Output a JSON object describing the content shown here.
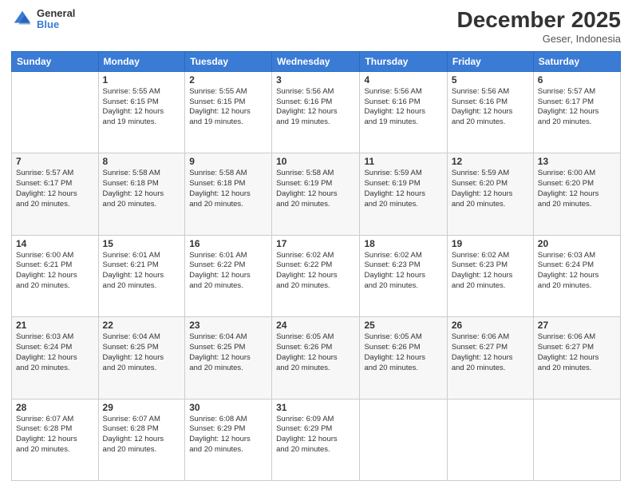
{
  "logo": {
    "general": "General",
    "blue": "Blue"
  },
  "header": {
    "month": "December 2025",
    "location": "Geser, Indonesia"
  },
  "weekdays": [
    "Sunday",
    "Monday",
    "Tuesday",
    "Wednesday",
    "Thursday",
    "Friday",
    "Saturday"
  ],
  "weeks": [
    [
      {
        "day": "",
        "info": ""
      },
      {
        "day": "1",
        "info": "Sunrise: 5:55 AM\nSunset: 6:15 PM\nDaylight: 12 hours\nand 19 minutes."
      },
      {
        "day": "2",
        "info": "Sunrise: 5:55 AM\nSunset: 6:15 PM\nDaylight: 12 hours\nand 19 minutes."
      },
      {
        "day": "3",
        "info": "Sunrise: 5:56 AM\nSunset: 6:16 PM\nDaylight: 12 hours\nand 19 minutes."
      },
      {
        "day": "4",
        "info": "Sunrise: 5:56 AM\nSunset: 6:16 PM\nDaylight: 12 hours\nand 19 minutes."
      },
      {
        "day": "5",
        "info": "Sunrise: 5:56 AM\nSunset: 6:16 PM\nDaylight: 12 hours\nand 20 minutes."
      },
      {
        "day": "6",
        "info": "Sunrise: 5:57 AM\nSunset: 6:17 PM\nDaylight: 12 hours\nand 20 minutes."
      }
    ],
    [
      {
        "day": "7",
        "info": "Sunrise: 5:57 AM\nSunset: 6:17 PM\nDaylight: 12 hours\nand 20 minutes."
      },
      {
        "day": "8",
        "info": "Sunrise: 5:58 AM\nSunset: 6:18 PM\nDaylight: 12 hours\nand 20 minutes."
      },
      {
        "day": "9",
        "info": "Sunrise: 5:58 AM\nSunset: 6:18 PM\nDaylight: 12 hours\nand 20 minutes."
      },
      {
        "day": "10",
        "info": "Sunrise: 5:58 AM\nSunset: 6:19 PM\nDaylight: 12 hours\nand 20 minutes."
      },
      {
        "day": "11",
        "info": "Sunrise: 5:59 AM\nSunset: 6:19 PM\nDaylight: 12 hours\nand 20 minutes."
      },
      {
        "day": "12",
        "info": "Sunrise: 5:59 AM\nSunset: 6:20 PM\nDaylight: 12 hours\nand 20 minutes."
      },
      {
        "day": "13",
        "info": "Sunrise: 6:00 AM\nSunset: 6:20 PM\nDaylight: 12 hours\nand 20 minutes."
      }
    ],
    [
      {
        "day": "14",
        "info": "Sunrise: 6:00 AM\nSunset: 6:21 PM\nDaylight: 12 hours\nand 20 minutes."
      },
      {
        "day": "15",
        "info": "Sunrise: 6:01 AM\nSunset: 6:21 PM\nDaylight: 12 hours\nand 20 minutes."
      },
      {
        "day": "16",
        "info": "Sunrise: 6:01 AM\nSunset: 6:22 PM\nDaylight: 12 hours\nand 20 minutes."
      },
      {
        "day": "17",
        "info": "Sunrise: 6:02 AM\nSunset: 6:22 PM\nDaylight: 12 hours\nand 20 minutes."
      },
      {
        "day": "18",
        "info": "Sunrise: 6:02 AM\nSunset: 6:23 PM\nDaylight: 12 hours\nand 20 minutes."
      },
      {
        "day": "19",
        "info": "Sunrise: 6:02 AM\nSunset: 6:23 PM\nDaylight: 12 hours\nand 20 minutes."
      },
      {
        "day": "20",
        "info": "Sunrise: 6:03 AM\nSunset: 6:24 PM\nDaylight: 12 hours\nand 20 minutes."
      }
    ],
    [
      {
        "day": "21",
        "info": "Sunrise: 6:03 AM\nSunset: 6:24 PM\nDaylight: 12 hours\nand 20 minutes."
      },
      {
        "day": "22",
        "info": "Sunrise: 6:04 AM\nSunset: 6:25 PM\nDaylight: 12 hours\nand 20 minutes."
      },
      {
        "day": "23",
        "info": "Sunrise: 6:04 AM\nSunset: 6:25 PM\nDaylight: 12 hours\nand 20 minutes."
      },
      {
        "day": "24",
        "info": "Sunrise: 6:05 AM\nSunset: 6:26 PM\nDaylight: 12 hours\nand 20 minutes."
      },
      {
        "day": "25",
        "info": "Sunrise: 6:05 AM\nSunset: 6:26 PM\nDaylight: 12 hours\nand 20 minutes."
      },
      {
        "day": "26",
        "info": "Sunrise: 6:06 AM\nSunset: 6:27 PM\nDaylight: 12 hours\nand 20 minutes."
      },
      {
        "day": "27",
        "info": "Sunrise: 6:06 AM\nSunset: 6:27 PM\nDaylight: 12 hours\nand 20 minutes."
      }
    ],
    [
      {
        "day": "28",
        "info": "Sunrise: 6:07 AM\nSunset: 6:28 PM\nDaylight: 12 hours\nand 20 minutes."
      },
      {
        "day": "29",
        "info": "Sunrise: 6:07 AM\nSunset: 6:28 PM\nDaylight: 12 hours\nand 20 minutes."
      },
      {
        "day": "30",
        "info": "Sunrise: 6:08 AM\nSunset: 6:29 PM\nDaylight: 12 hours\nand 20 minutes."
      },
      {
        "day": "31",
        "info": "Sunrise: 6:09 AM\nSunset: 6:29 PM\nDaylight: 12 hours\nand 20 minutes."
      },
      {
        "day": "",
        "info": ""
      },
      {
        "day": "",
        "info": ""
      },
      {
        "day": "",
        "info": ""
      }
    ]
  ]
}
